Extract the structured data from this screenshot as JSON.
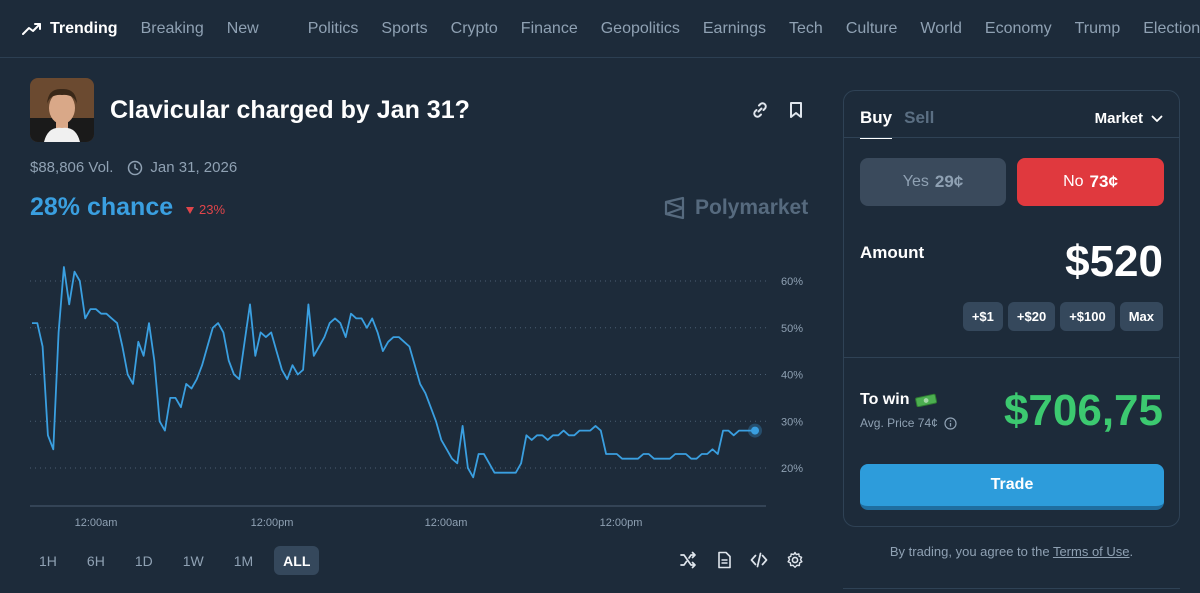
{
  "nav": {
    "trending": "Trending",
    "items": [
      "Breaking",
      "New",
      "Politics",
      "Sports",
      "Crypto",
      "Finance",
      "Geopolitics",
      "Earnings",
      "Tech",
      "Culture",
      "World",
      "Economy",
      "Trump",
      "Elections"
    ]
  },
  "market": {
    "title": "Clavicular charged by Jan 31?",
    "volume": "$88,806 Vol.",
    "end_date": "Jan 31, 2026",
    "chance": "28% chance",
    "delta": "23%",
    "brand": "Polymarket"
  },
  "chart_data": {
    "type": "line",
    "x_ticks": [
      "12:00am",
      "12:00pm",
      "12:00am",
      "12:00pm"
    ],
    "y_ticks": [
      "60%",
      "50%",
      "40%",
      "30%",
      "20%"
    ],
    "ylim": [
      10,
      65
    ],
    "grid": true,
    "series": [
      {
        "values": [
          51,
          51,
          46,
          27,
          24,
          49,
          63,
          55,
          62,
          60,
          52,
          54,
          54,
          53,
          53,
          52,
          51,
          46,
          40,
          38,
          47,
          44,
          51,
          43,
          30,
          28,
          35,
          35,
          33,
          38,
          37,
          39,
          42,
          46,
          50,
          51,
          49,
          43,
          40,
          39,
          47,
          55,
          44,
          49,
          48,
          49,
          45,
          41,
          39,
          42,
          40,
          41,
          55,
          44,
          46,
          48,
          51,
          52,
          51,
          48,
          53,
          52,
          52,
          50,
          52,
          49,
          45,
          47,
          48,
          48,
          47,
          46,
          42,
          38,
          36,
          33,
          30,
          26,
          24,
          22,
          21,
          29,
          20,
          18,
          23,
          23,
          21,
          19,
          19,
          19,
          19,
          19,
          21,
          27,
          26,
          27,
          27,
          26,
          27,
          27,
          28,
          27,
          27,
          28,
          28,
          28,
          29,
          28,
          23,
          23,
          23,
          22,
          22,
          22,
          22,
          23,
          23,
          22,
          22,
          22,
          22,
          23,
          23,
          23,
          22,
          22,
          23,
          23,
          24,
          23,
          28,
          28,
          27,
          28,
          28,
          28,
          28
        ]
      }
    ]
  },
  "ranges": [
    "1H",
    "6H",
    "1D",
    "1W",
    "1M",
    "ALL"
  ],
  "trade": {
    "buy": "Buy",
    "sell": "Sell",
    "order_type": "Market",
    "yes_label": "Yes",
    "yes_price": "29¢",
    "no_label": "No",
    "no_price": "73¢",
    "amount_label": "Amount",
    "amount": "$520",
    "quick": [
      "+$1",
      "+$20",
      "+$100",
      "Max"
    ],
    "to_win_label": "To win",
    "avg_price": "Avg. Price 74¢",
    "to_win": "$706,75",
    "trade_button": "Trade",
    "terms_prefix": "By trading, you agree to the ",
    "terms_link": "Terms of Use",
    "terms_suffix": "."
  },
  "colors": {
    "background": "#1d2b3a",
    "accent": "#3a9fe0",
    "no": "#e0393e",
    "win": "#3cc970",
    "trade": "#2d9cdb"
  }
}
